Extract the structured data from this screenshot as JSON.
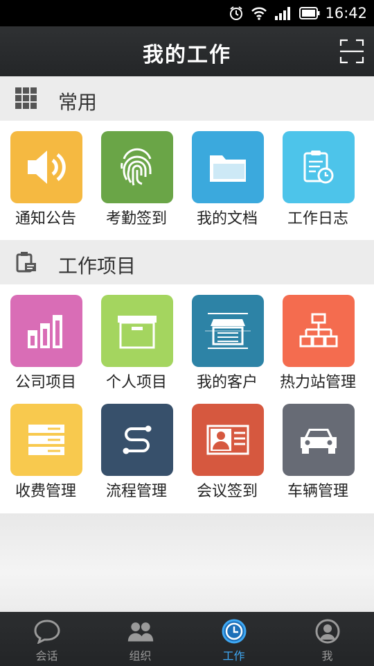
{
  "status_bar": {
    "time": "16:42",
    "icons": [
      "alarm-icon",
      "wifi-icon",
      "signal-icon",
      "battery-icon"
    ]
  },
  "header": {
    "title": "我的工作",
    "scan_icon": "scan-icon"
  },
  "sections": {
    "common": {
      "label": "常用",
      "icon": "grid-icon"
    },
    "projects": {
      "label": "工作项目",
      "icon": "clipboard-icon"
    }
  },
  "common_items": [
    {
      "label": "通知公告",
      "icon": "speaker-icon",
      "color": "#f5b941"
    },
    {
      "label": "考勤签到",
      "icon": "fingerprint-icon",
      "color": "#6aa547"
    },
    {
      "label": "我的文档",
      "icon": "folder-icon",
      "color": "#3ba9dd"
    },
    {
      "label": "工作日志",
      "icon": "clipboard-clock-icon",
      "color": "#4dc4ea"
    }
  ],
  "project_items": [
    {
      "label": "公司项目",
      "icon": "bar-chart-icon",
      "color": "#d96db6"
    },
    {
      "label": "个人项目",
      "icon": "archive-box-icon",
      "color": "#a4d55f"
    },
    {
      "label": "我的客户",
      "icon": "storefront-icon",
      "color": "#2d83a6"
    },
    {
      "label": "热力站管理",
      "icon": "org-chart-icon",
      "color": "#f46c4f"
    },
    {
      "label": "收费管理",
      "icon": "server-stack-icon",
      "color": "#f8c94e"
    },
    {
      "label": "流程管理",
      "icon": "flow-path-icon",
      "color": "#37506b"
    },
    {
      "label": "会议签到",
      "icon": "id-card-icon",
      "color": "#d6583f"
    },
    {
      "label": "车辆管理",
      "icon": "car-icon",
      "color": "#676b75"
    }
  ],
  "tabs": [
    {
      "label": "会话",
      "icon": "chat-bubble-icon",
      "active": false
    },
    {
      "label": "组织",
      "icon": "people-icon",
      "active": false
    },
    {
      "label": "工作",
      "icon": "clock-icon",
      "active": true
    },
    {
      "label": "我",
      "icon": "user-icon",
      "active": false
    }
  ]
}
